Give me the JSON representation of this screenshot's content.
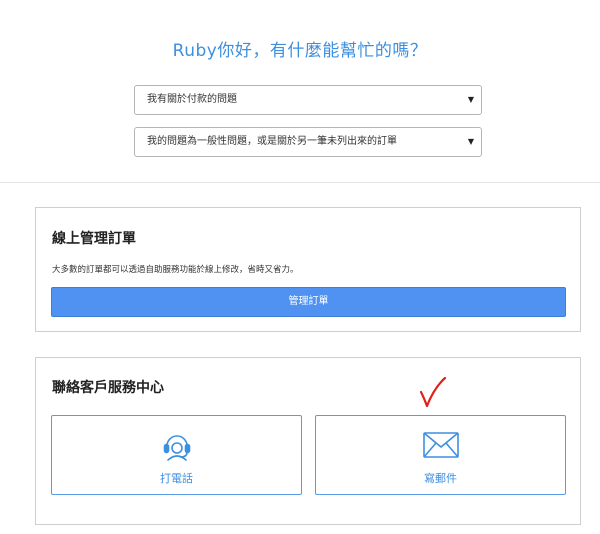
{
  "greeting": "Ruby你好，有什麼能幫忙的嗎？",
  "selects": [
    {
      "value": "我有關於付款的問題"
    },
    {
      "value": "我的問題為一般性問題，或是關於另一筆未列出來的訂單"
    }
  ],
  "manage": {
    "title": "線上管理訂單",
    "description": "大多數的訂單都可以透過自助服務功能於線上修改，省時又省力。",
    "button_label": "管理訂單"
  },
  "contact": {
    "title": "聯絡客戶服務中心",
    "phone_label": "打電話",
    "mail_label": "寫郵件"
  },
  "icons": {
    "caret": "caret-down-icon",
    "phone": "headset-icon",
    "mail": "envelope-icon",
    "annotation": "red-checkmark"
  },
  "colors": {
    "accent": "#3d8fe0",
    "button": "#4f92f2",
    "checkmark": "#e0201c"
  }
}
